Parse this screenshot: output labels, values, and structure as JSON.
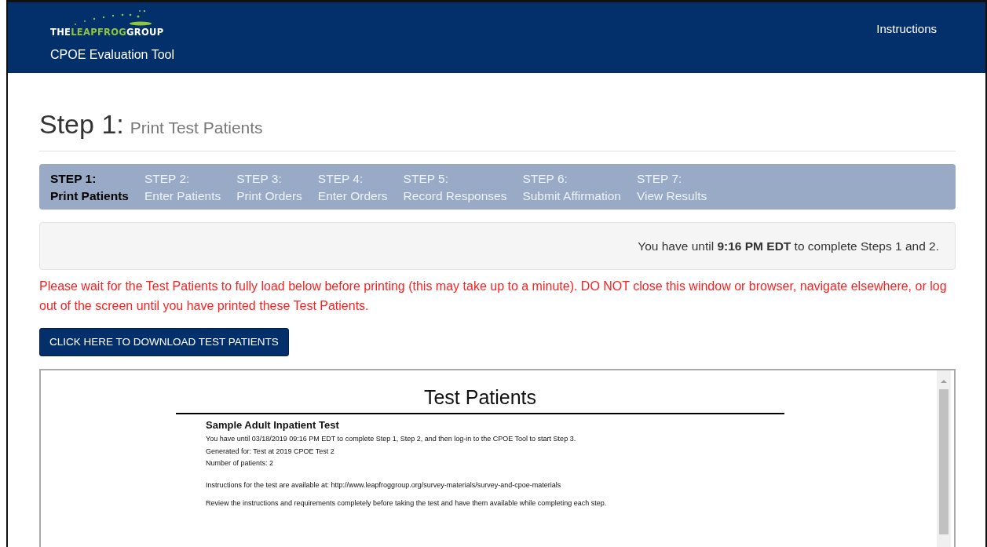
{
  "header": {
    "logo": [
      "THE",
      "LEAPFROG",
      "GROUP"
    ],
    "app_title": "CPOE Evaluation Tool",
    "nav_link": "Instructions"
  },
  "page_title": {
    "step": "Step 1:",
    "subtitle": "Print Test Patients"
  },
  "steps": [
    {
      "label": "STEP 1:",
      "name": "Print Patients",
      "selected": true
    },
    {
      "label": "STEP 2:",
      "name": "Enter Patients",
      "selected": false
    },
    {
      "label": "STEP 3:",
      "name": "Print Orders",
      "selected": false
    },
    {
      "label": "STEP 4:",
      "name": "Enter Orders",
      "selected": false
    },
    {
      "label": "STEP 5:",
      "name": "Record Responses",
      "selected": false
    },
    {
      "label": "STEP 6:",
      "name": "Submit Affirmation",
      "selected": false
    },
    {
      "label": "STEP 7:",
      "name": "View Results",
      "selected": false
    }
  ],
  "deadline_notice": "You have until **9:16 PM EDT** to complete Steps 1 and 2.",
  "warning": "Please wait for the Test Patients to fully load below before printing (this may take up to a minute). DO NOT close this window or browser, navigate elsewhere, or log out of the screen until you have printed these Test Patients.",
  "download_button": "CLICK HERE TO DOWNLOAD TEST PATIENTS",
  "document": {
    "title": "Test Patients",
    "test_name": "Sample Adult Inpatient Test",
    "lines": [
      "You have until 03/18/2019 09:16 PM EDT to complete Step 1, Step 2, and then log-in to the CPOE Tool to start Step 3.",
      "Generated for: Test at 2019 CPOE Test 2",
      "Number of patients: 2"
    ],
    "paragraphs": [
      "Instructions for the test are available at: http://www.leapfroggroup.org/survey-materials/survey-and-cpoe-materials",
      "Review the instructions and requirements completely before taking the test and have them available while completing each step."
    ]
  }
}
